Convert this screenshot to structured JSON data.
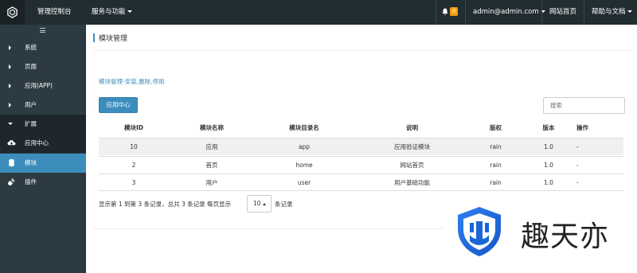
{
  "topbar": {
    "console": "管理控制台",
    "services": "服务与功能",
    "notify_count": "0",
    "user": "admin@admin.com",
    "home": "网站首页",
    "help": "帮助与文档"
  },
  "sidebar": {
    "items": [
      {
        "label": "系统"
      },
      {
        "label": "页面"
      },
      {
        "label": "应用(APP)"
      },
      {
        "label": "用户"
      },
      {
        "label": "扩展"
      },
      {
        "label": "应用中心"
      },
      {
        "label": "模块"
      },
      {
        "label": "插件"
      }
    ]
  },
  "main": {
    "title": "模块管理",
    "description": "模块管理-安装,删除,停用",
    "app_center_button": "应用中心",
    "search_placeholder": "搜索"
  },
  "table": {
    "headers": [
      "模块ID",
      "模块名称",
      "模块目录名",
      "说明",
      "版权",
      "版本",
      "操作"
    ],
    "rows": [
      [
        "10",
        "应用",
        "app",
        "应用验证模块",
        "rain",
        "1.0",
        "-"
      ],
      [
        "2",
        "首页",
        "home",
        "网站首页",
        "rain",
        "1.0",
        "-"
      ],
      [
        "3",
        "用户",
        "user",
        "用户基础功能",
        "rain",
        "1.0",
        "-"
      ]
    ]
  },
  "pagination": {
    "summary": "显示第 1 到第 3 条记录，总共 3 条记录 每页显示",
    "page_size": "10",
    "suffix": "条记录"
  },
  "watermark": {
    "text": "趣天亦"
  },
  "colors": {
    "topbar": "#222d32",
    "sidebar": "#2c3b41",
    "accent": "#3c8dbc",
    "badge": "#f39c12"
  }
}
